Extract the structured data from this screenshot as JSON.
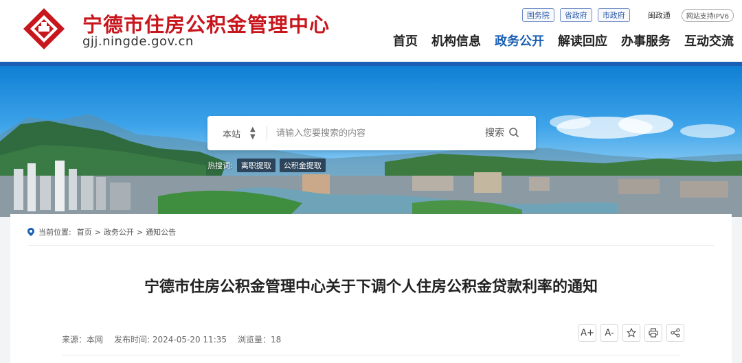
{
  "header": {
    "site_title": "宁德市住房公积金管理中心",
    "site_domain": "gjj.ningde.gov.cn",
    "top_links": [
      "国务院",
      "省政府",
      "市政府"
    ],
    "top_plain": "闽政通",
    "ipv6": "网站支持IPV6",
    "nav": [
      "首页",
      "机构信息",
      "政务公开",
      "解读回应",
      "办事服务",
      "互动交流"
    ],
    "nav_active": "政务公开"
  },
  "search": {
    "scope": "本站",
    "placeholder": "请输入您要搜索的内容",
    "button": "搜索",
    "hot_label": "热搜词:",
    "hot_tags": [
      "离职提取",
      "公积金提取"
    ]
  },
  "breadcrumb": {
    "label": "当前位置:",
    "items": [
      "首页",
      "政务公开",
      "通知公告"
    ]
  },
  "article": {
    "title": "宁德市住房公积金管理中心关于下调个人住房公积金贷款利率的通知",
    "source": "来源：本网",
    "published": "发布时间: 2024-05-20 11:35",
    "views": "浏览量：18"
  },
  "tools": {
    "font_up": "A+",
    "font_down": "A-"
  },
  "colors": {
    "brand_red": "#c8161d",
    "brand_blue": "#1a5fb4"
  }
}
